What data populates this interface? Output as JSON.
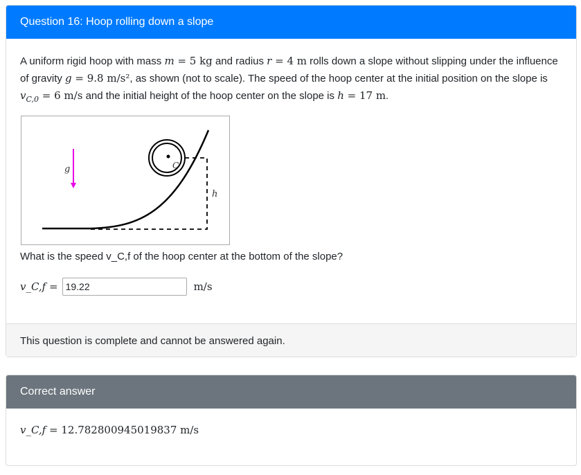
{
  "question_card": {
    "title": "Question 16: Hoop rolling down a slope",
    "prompt": {
      "t1": "A uniform rigid hoop with mass ",
      "m_var": "m",
      "m_eq": " = 5 kg",
      "t2": " and radius ",
      "r_var": "r",
      "r_eq": " = 4 m",
      "t3": " rolls down a slope without slipping under the influence of gravity ",
      "g_var": "g",
      "g_eq": " = 9.8 m/s²",
      "t4": ", as shown (not to scale). The speed of the hoop center at the initial position on the slope is ",
      "v_var": "v",
      "v_sub": "C,0",
      "v_eq": " = 6 m/s",
      "t5": " and the initial height of the hoop center on the slope is ",
      "h_var": "h",
      "h_eq": " = 17 m",
      "t6": "."
    },
    "figure": {
      "g_label": "g",
      "c_label": "C",
      "h_label": "h",
      "gravity_arrow_color": "#e800e8"
    },
    "question_text": "What is the speed v_C,f of the hoop center at the bottom of the slope?",
    "answer": {
      "label": "v_C,f =",
      "value": "19.22",
      "unit": "m/s"
    },
    "footer_text": "This question is complete and cannot be answered again."
  },
  "correct_card": {
    "title": "Correct answer",
    "label": "v_C,f",
    "value": "= 12.782800945019837 m/s"
  },
  "colors": {
    "primary": "#007bff",
    "secondary": "#6c757d",
    "footer_bg": "#f5f5f5"
  }
}
